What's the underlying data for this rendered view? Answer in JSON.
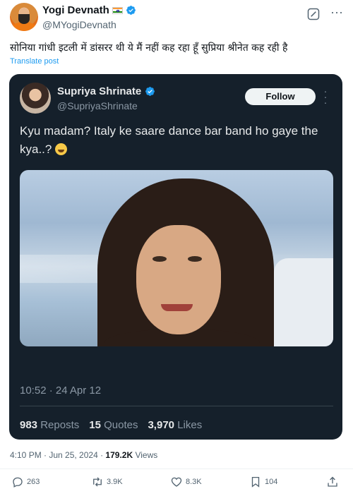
{
  "author": {
    "name": "Yogi Devnath",
    "handle": "@MYogiDevnath",
    "flag_icon": "india-flag-icon",
    "verified_color": "#1d9bf0"
  },
  "post": {
    "text": "सोनिया गांधी इटली में डांसरर थी ये मैं नहीं कह रहा हूँ सुप्रिया श्रीनेत कह रही है",
    "translate_label": "Translate post"
  },
  "embedded": {
    "name": "Supriya Shrinate",
    "handle": "@SupriyaShrinate",
    "follow_label": "Follow",
    "text": "Kyu madam? Italy ke saare dance bar band ho gaye the kya..?",
    "emoji_icon": "laughing-tears-emoji",
    "timestamp": "10:52 · 24 Apr 12",
    "stats": {
      "reposts_count": "983",
      "reposts_label": "Reposts",
      "quotes_count": "15",
      "quotes_label": "Quotes",
      "likes_count": "3,970",
      "likes_label": "Likes"
    },
    "background": "#15202b"
  },
  "meta": {
    "time": "4:10 PM · Jun 25, 2024 · ",
    "views_count": "179.2K",
    "views_label": " Views"
  },
  "actions": {
    "replies": "263",
    "reposts": "3.9K",
    "likes": "8.3K",
    "bookmarks": "104"
  }
}
